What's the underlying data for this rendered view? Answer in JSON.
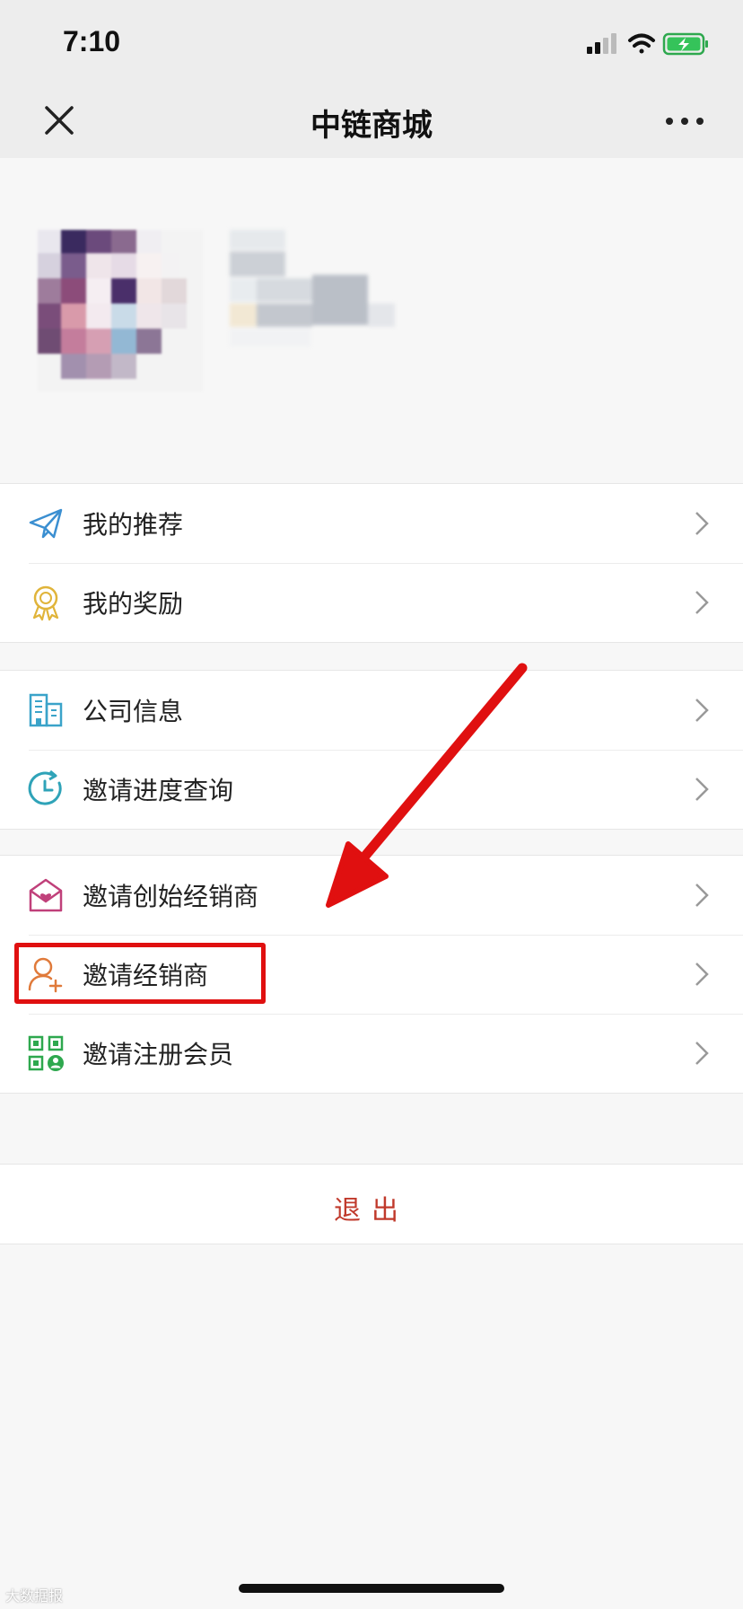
{
  "status_bar": {
    "time": "7:10"
  },
  "nav": {
    "title": "中链商城",
    "close_icon": "close-icon",
    "more_icon": "more-icon"
  },
  "groups": [
    {
      "items": [
        {
          "label": "我的推荐",
          "icon": "paper-plane-icon",
          "color": "#3b8fd1"
        },
        {
          "label": "我的奖励",
          "icon": "award-medal-icon",
          "color": "#e0b43a"
        }
      ]
    },
    {
      "items": [
        {
          "label": "公司信息",
          "icon": "building-icon",
          "color": "#3aa3c9"
        },
        {
          "label": "邀请进度查询",
          "icon": "clock-icon",
          "color": "#2fa3b8"
        }
      ]
    },
    {
      "items": [
        {
          "label": "邀请创始经销商",
          "icon": "heart-envelope-icon",
          "color": "#c0407a"
        },
        {
          "label": "邀请经销商",
          "icon": "user-add-icon",
          "color": "#e07a3a"
        },
        {
          "label": "邀请注册会员",
          "icon": "qr-user-icon",
          "color": "#2ea84e"
        }
      ]
    }
  ],
  "logout": {
    "label": "退出",
    "color": "#c0392b"
  },
  "annotation": {
    "color": "#e01010"
  },
  "watermark": "大数据报"
}
